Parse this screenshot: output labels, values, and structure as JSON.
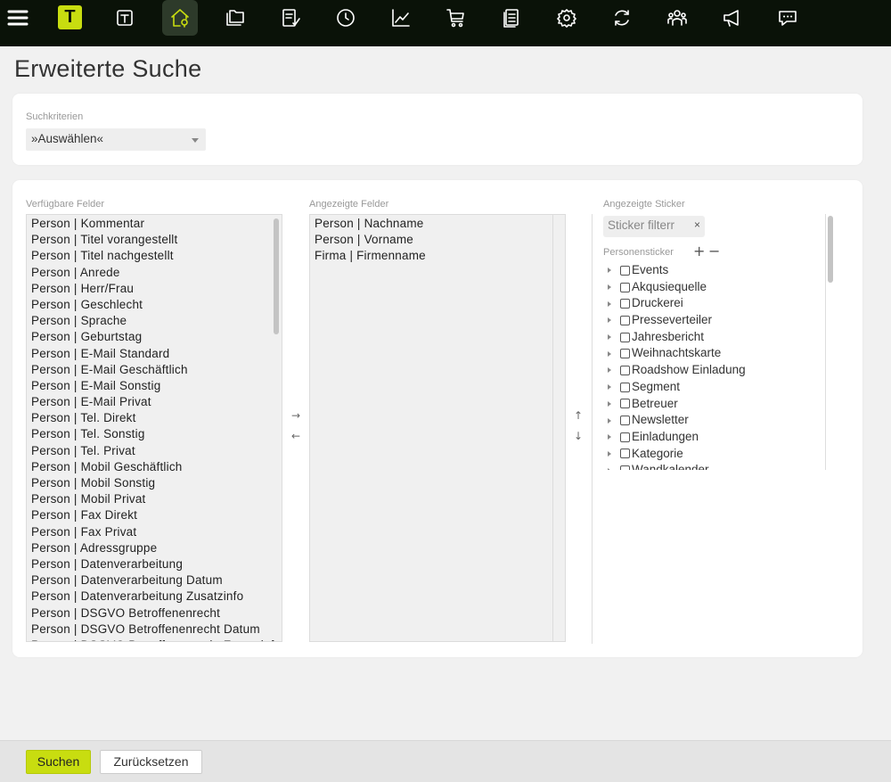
{
  "page_title": "Erweiterte Suche",
  "search_criteria": {
    "label": "Suchkriterien",
    "selected": "»Auswählen«"
  },
  "available_fields": {
    "label": "Verfügbare Felder",
    "items": [
      "Person | Kommentar",
      "Person | Titel vorangestellt",
      "Person | Titel nachgestellt",
      "Person | Anrede",
      "Person | Herr/Frau",
      "Person | Geschlecht",
      "Person | Sprache",
      "Person | Geburtstag",
      "Person | E-Mail Standard",
      "Person | E-Mail Geschäftlich",
      "Person | E-Mail Sonstig",
      "Person | E-Mail Privat",
      "Person | Tel. Direkt",
      "Person | Tel. Sonstig",
      "Person | Tel. Privat",
      "Person | Mobil Geschäftlich",
      "Person | Mobil Sonstig",
      "Person | Mobil Privat",
      "Person | Fax Direkt",
      "Person | Fax Privat",
      "Person | Adressgruppe",
      "Person | Datenverarbeitung",
      "Person | Datenverarbeitung Datum",
      "Person | Datenverarbeitung Zusatzinfo",
      "Person | DSGVO Betroffenenrecht",
      "Person | DSGVO Betroffenenrecht Datum",
      "Person | DSGVO Betroffenenrecht Zusatzinfo"
    ]
  },
  "displayed_fields": {
    "label": "Angezeigte Felder",
    "items": [
      "Person | Nachname",
      "Person | Vorname",
      "Firma | Firmenname"
    ]
  },
  "transfer": {
    "add": "→",
    "remove": "←",
    "up": "↑",
    "down": "↓"
  },
  "stickers": {
    "label": "Angezeigte Sticker",
    "filter_value": "Sticker filterr",
    "clear": "×",
    "group_label": "Personensticker",
    "plus": "+",
    "minus": "−",
    "items": [
      "Events",
      "Akqusiequelle",
      "Druckerei",
      "Presseverteiler",
      "Jahresbericht",
      "Weihnachtskarte",
      "Roadshow Einladung",
      "Segment",
      "Betreuer",
      "Newsletter",
      "Einladungen",
      "Kategorie",
      "Wandkalender"
    ]
  },
  "footer": {
    "search_label": "Suchen",
    "reset_label": "Zurücksetzen"
  },
  "colors": {
    "accent": "#c8dd10",
    "topbar": "#0a1208"
  },
  "toolbar_icons": [
    "menu-icon",
    "logo-t",
    "text-icon",
    "home-location-icon",
    "folders-icon",
    "checklist-icon",
    "clock-icon",
    "chart-icon",
    "cart-icon",
    "documents-icon",
    "gear-icon",
    "refresh-icon",
    "users-icon",
    "megaphone-icon",
    "chat-icon"
  ]
}
